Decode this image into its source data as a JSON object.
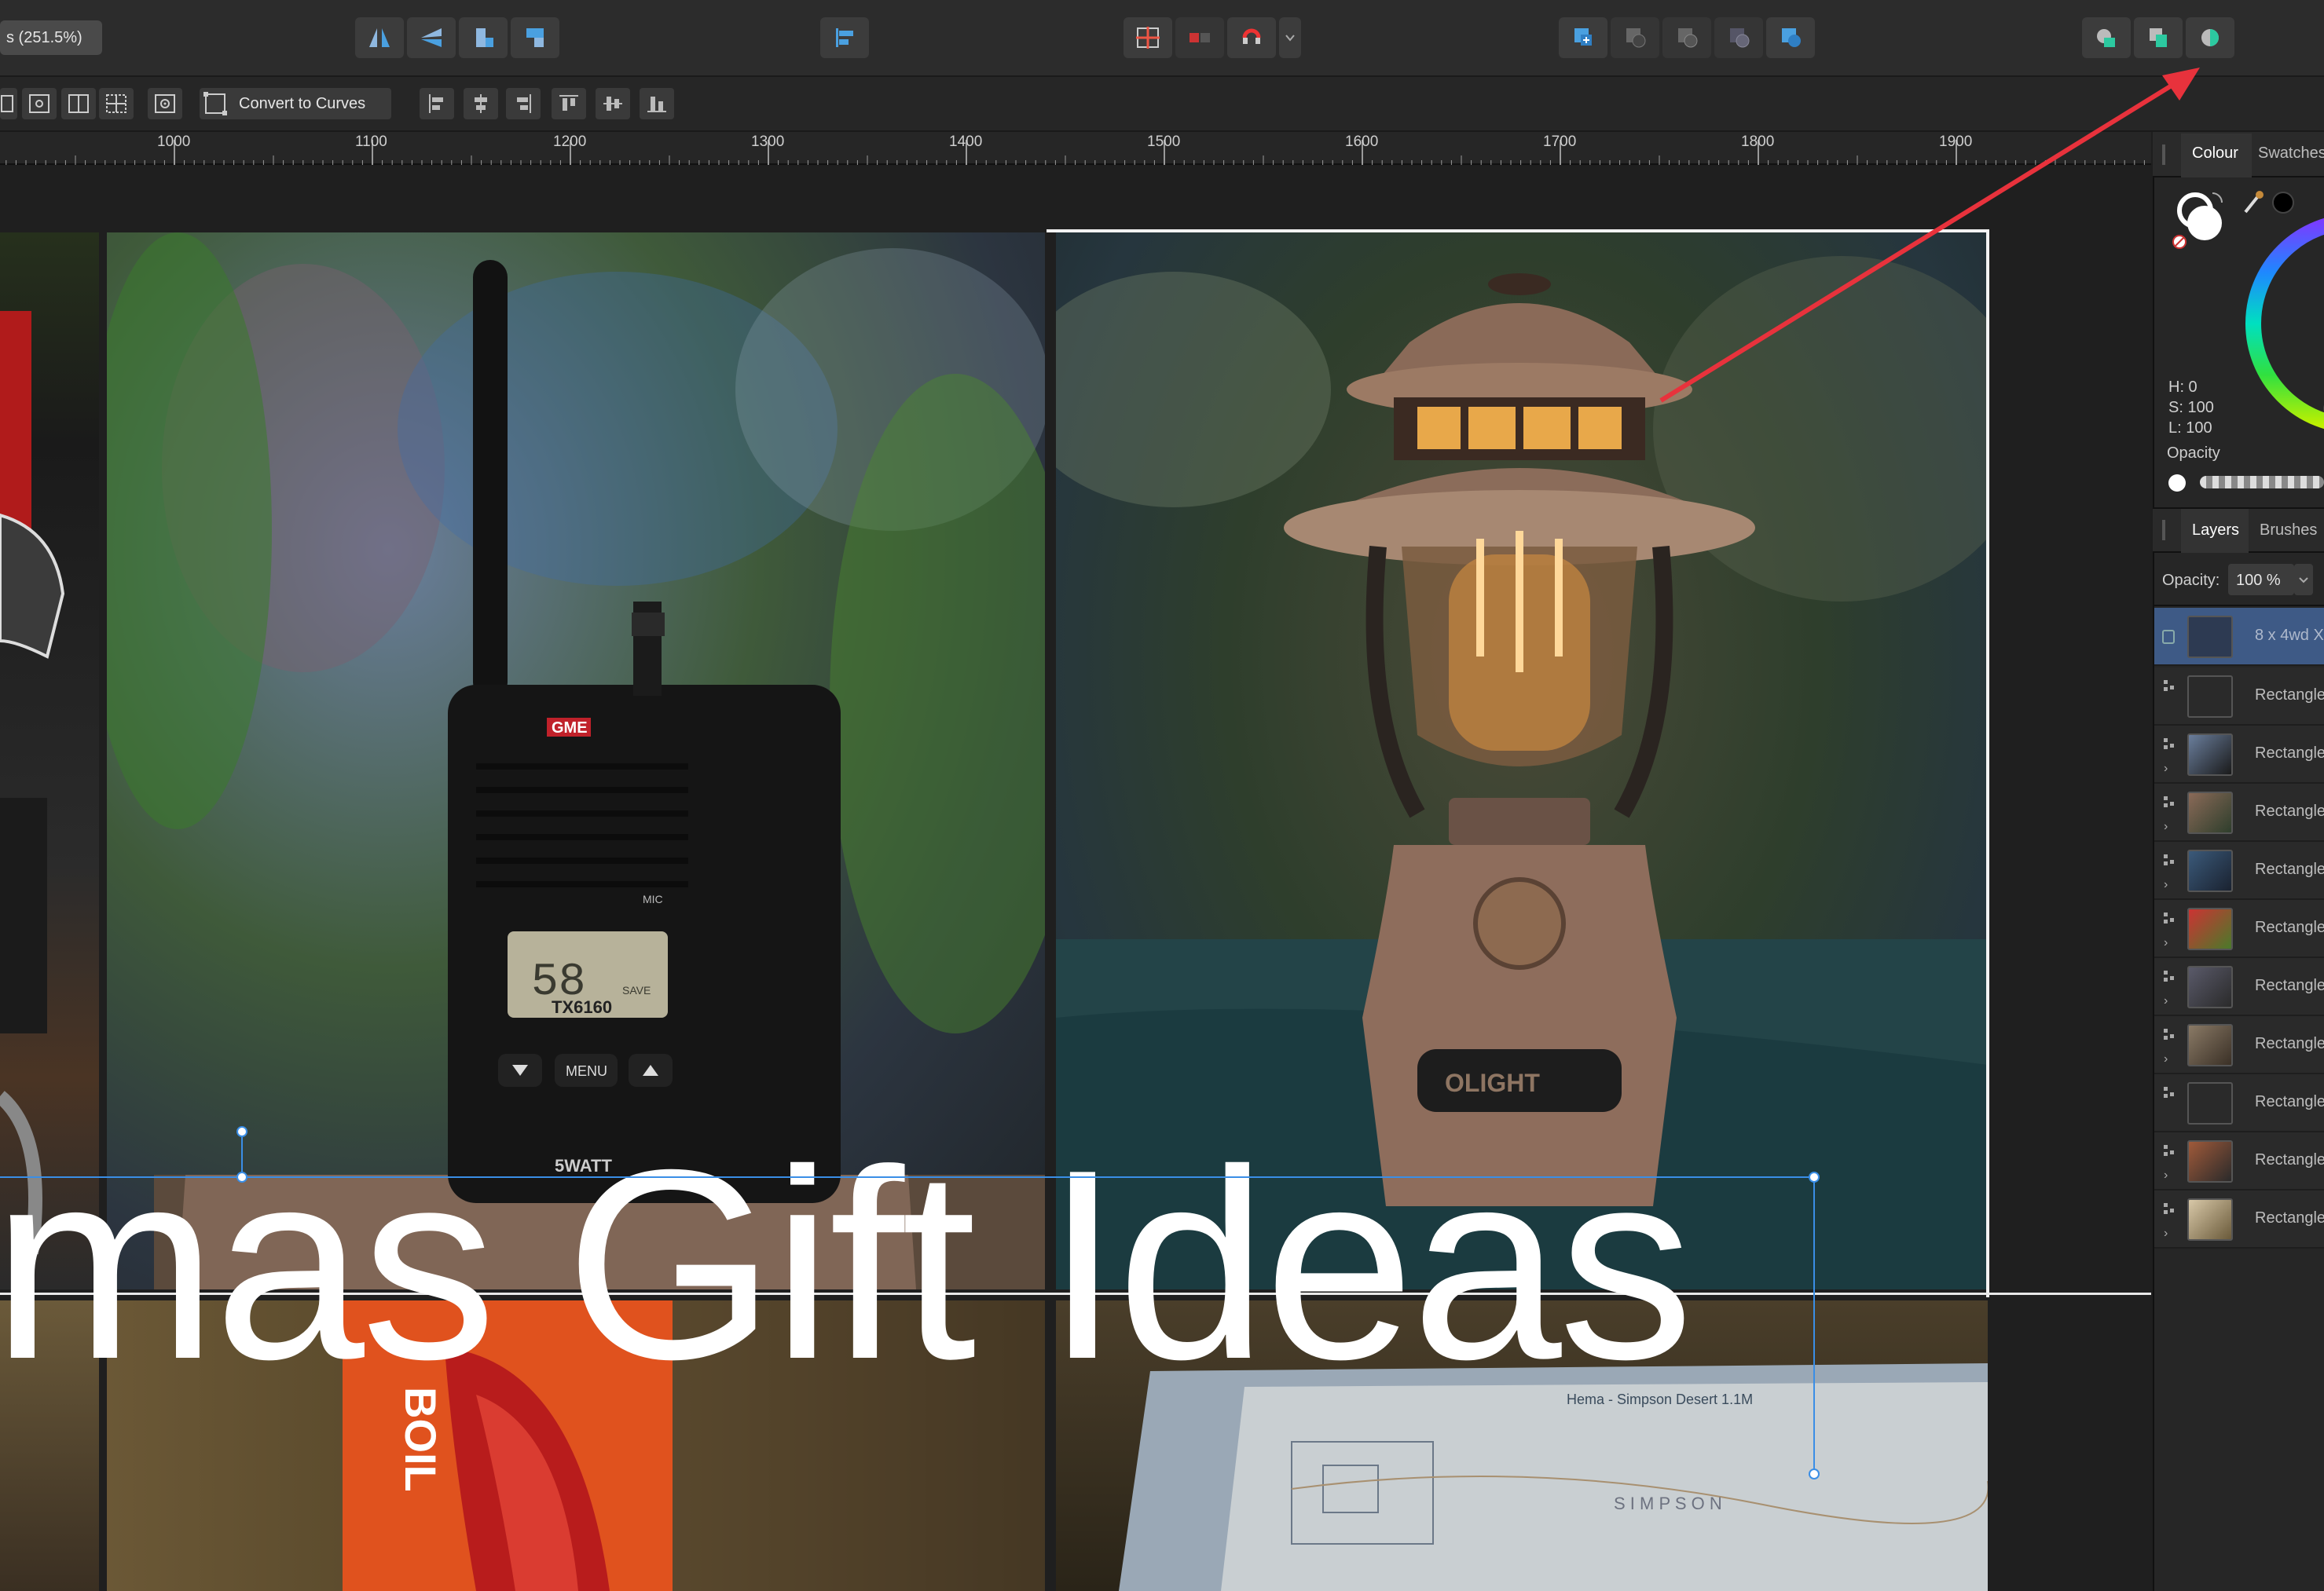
{
  "toolbar": {
    "zoom_value": "s (251.5%)"
  },
  "context_bar": {
    "convert_to_curves_label": "Convert to Curves"
  },
  "ruler": {
    "labels": [
      "1000",
      "1100",
      "1200",
      "1300",
      "1400",
      "1500",
      "1600",
      "1700",
      "1800",
      "1900"
    ]
  },
  "canvas": {
    "headline_text": "mas Gift Ideas",
    "radio": {
      "brand": "GME",
      "display": "58",
      "model": "TX6160",
      "menu": "MENU",
      "save": "SAVE",
      "mic": "MIC",
      "swatt": "5WATT"
    },
    "lantern": {
      "brand": "OLIGHT"
    },
    "stove": {
      "brand": "BOIL"
    },
    "map": {
      "title": "Hema - Simpson Desert 1.1M",
      "label": "S I M P S O N"
    }
  },
  "annotation": {
    "arrow_color": "#e8323c"
  },
  "panel": {
    "colour_tabs": [
      "Colour",
      "Swatches"
    ],
    "hsl": {
      "h": "H: 0",
      "s": "S: 100",
      "l": "L: 100"
    },
    "opacity_label": "Opacity",
    "layer_tabs": [
      "Layers",
      "Brushes"
    ],
    "layers_opacity_label": "Opacity:",
    "layers_opacity_value": "100 %",
    "layers": [
      {
        "name": "8 x 4wd X",
        "selected": true
      },
      {
        "name": "Rectangle"
      },
      {
        "name": "Rectangle"
      },
      {
        "name": "Rectangle"
      },
      {
        "name": "Rectangle"
      },
      {
        "name": "Rectangle"
      },
      {
        "name": "Rectangle"
      },
      {
        "name": "Rectangle"
      },
      {
        "name": "Rectangle"
      },
      {
        "name": "Rectangle"
      },
      {
        "name": "Rectangle"
      }
    ]
  },
  "colors": {
    "accent": "#3a8ee6",
    "panel_bg": "#262626",
    "toolbar_bg": "#2c2c2c"
  }
}
